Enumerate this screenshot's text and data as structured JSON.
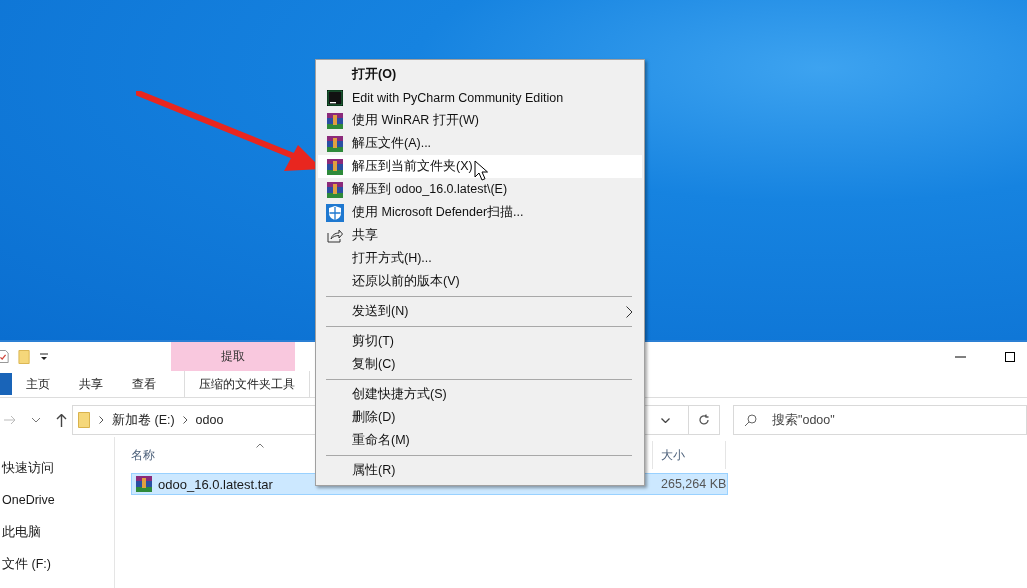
{
  "context_menu": {
    "items": [
      {
        "kind": "plain",
        "label": "打开(O)",
        "default": true,
        "selected": false,
        "submenu": false
      },
      {
        "kind": "pycharm",
        "label": "Edit with PyCharm Community Edition",
        "default": false,
        "selected": false,
        "submenu": false
      },
      {
        "kind": "archive",
        "label": "使用 WinRAR 打开(W)",
        "default": false,
        "selected": false,
        "submenu": false
      },
      {
        "kind": "archive",
        "label": "解压文件(A)...",
        "default": false,
        "selected": false,
        "submenu": false
      },
      {
        "kind": "archive",
        "label": "解压到当前文件夹(X)",
        "default": false,
        "selected": true,
        "submenu": false
      },
      {
        "kind": "archive",
        "label": "解压到 odoo_16.0.latest\\(E)",
        "default": false,
        "selected": false,
        "submenu": false
      },
      {
        "kind": "shield",
        "label": "使用 Microsoft Defender扫描...",
        "default": false,
        "selected": false,
        "submenu": false
      },
      {
        "kind": "share",
        "label": "共享",
        "default": false,
        "selected": false,
        "submenu": false
      },
      {
        "kind": "plain",
        "label": "打开方式(H)...",
        "default": false,
        "selected": false,
        "submenu": false
      },
      {
        "kind": "plain",
        "label": "还原以前的版本(V)",
        "default": false,
        "selected": false,
        "submenu": false
      },
      {
        "kind": "separator"
      },
      {
        "kind": "plain",
        "label": "发送到(N)",
        "default": false,
        "selected": false,
        "submenu": true
      },
      {
        "kind": "separator"
      },
      {
        "kind": "plain",
        "label": "剪切(T)",
        "default": false,
        "selected": false,
        "submenu": false
      },
      {
        "kind": "plain",
        "label": "复制(C)",
        "default": false,
        "selected": false,
        "submenu": false
      },
      {
        "kind": "separator"
      },
      {
        "kind": "plain",
        "label": "创建快捷方式(S)",
        "default": false,
        "selected": false,
        "submenu": false
      },
      {
        "kind": "plain",
        "label": "删除(D)",
        "default": false,
        "selected": false,
        "submenu": false
      },
      {
        "kind": "plain",
        "label": "重命名(M)",
        "default": false,
        "selected": false,
        "submenu": false
      },
      {
        "kind": "separator"
      },
      {
        "kind": "plain",
        "label": "属性(R)",
        "default": false,
        "selected": false,
        "submenu": false
      }
    ]
  },
  "explorer": {
    "context_tab": {
      "group": "提取",
      "label": "压缩的文件夹工具"
    },
    "ribbon_tabs": [
      "主页",
      "共享",
      "查看"
    ],
    "breadcrumb": [
      "新加卷 (E:)",
      "odoo"
    ],
    "search": {
      "placeholder": "搜索\"odoo\""
    },
    "nav_items": [
      "快速访问",
      "OneDrive",
      "此电脑",
      "文件 (F:)"
    ],
    "columns": [
      "名称",
      "大小"
    ],
    "rows": [
      {
        "name": "odoo_16.0.latest.tar",
        "size": "265,264 KB",
        "selected": true
      }
    ]
  }
}
